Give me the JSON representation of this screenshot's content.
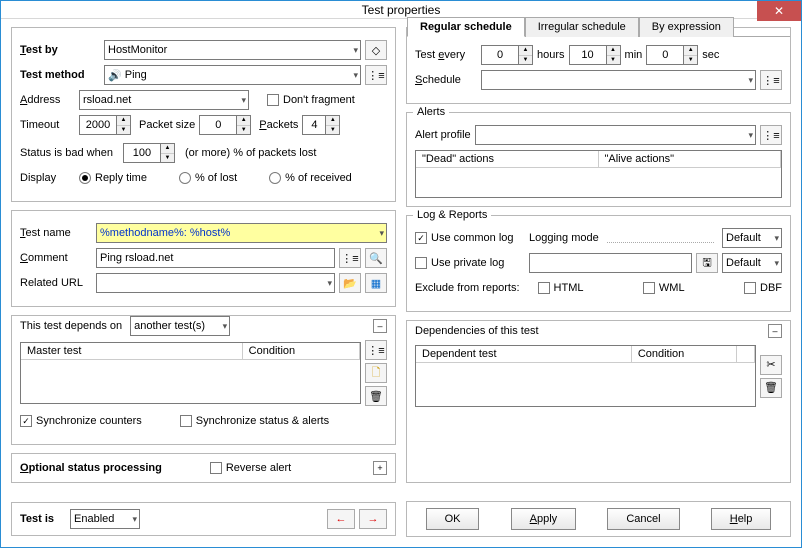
{
  "title": "Test properties",
  "left": {
    "testby_label": "Test by",
    "testby_value": "HostMonitor",
    "testmethod_label": "Test method",
    "testmethod_value": "Ping",
    "address_label": "Address",
    "address_value": "rsload.net",
    "dontfragment": "Don't fragment",
    "timeout_label": "Timeout",
    "timeout_value": "2000",
    "packetsize_label": "Packet size",
    "packetsize_value": "0",
    "packets_label": "Packets",
    "packets_value": "4",
    "statusbad_label": "Status is bad when",
    "statusbad_value": "100",
    "statusbad_suffix": "(or more) % of packets lost",
    "display_label": "Display",
    "display_opts": [
      "Reply time",
      "% of lost",
      "% of received"
    ],
    "testname_label": "Test name",
    "testname_value": "%methodname%: %host%",
    "comment_label": "Comment",
    "comment_value": "Ping rsload.net",
    "relatedurl_label": "Related URL",
    "relatedurl_value": "",
    "dependson_label": "This test depends on",
    "dependson_value": "another test(s)",
    "mastertest": "Master test",
    "condition": "Condition",
    "sync_counters": "Synchronize counters",
    "sync_status": "Synchronize status & alerts",
    "optional_label": "Optional status processing",
    "reverse_alert": "Reverse alert"
  },
  "right": {
    "tabs": [
      "Regular schedule",
      "Irregular schedule",
      "By expression"
    ],
    "testevery_label": "Test every",
    "hours_value": "0",
    "hours_label": "hours",
    "min_value": "10",
    "min_label": "min",
    "sec_value": "0",
    "sec_label": "sec",
    "schedule_label": "Schedule",
    "alerts_label": "Alerts",
    "alertprofile_label": "Alert profile",
    "dead_actions": "\"Dead\" actions",
    "alive_actions": "\"Alive actions\"",
    "log_label": "Log & Reports",
    "common_log": "Use common log",
    "logging_mode": "Logging mode",
    "default": "Default",
    "private_log": "Use private log",
    "exclude_label": "Exclude from reports:",
    "html": "HTML",
    "wml": "WML",
    "dbf": "DBF",
    "deps_label": "Dependencies of this test",
    "dependent_test": "Dependent test",
    "condition": "Condition"
  },
  "bottom": {
    "testis": "Test is",
    "testis_value": "Enabled",
    "ok": "OK",
    "apply": "Apply",
    "cancel": "Cancel",
    "help": "Help"
  }
}
